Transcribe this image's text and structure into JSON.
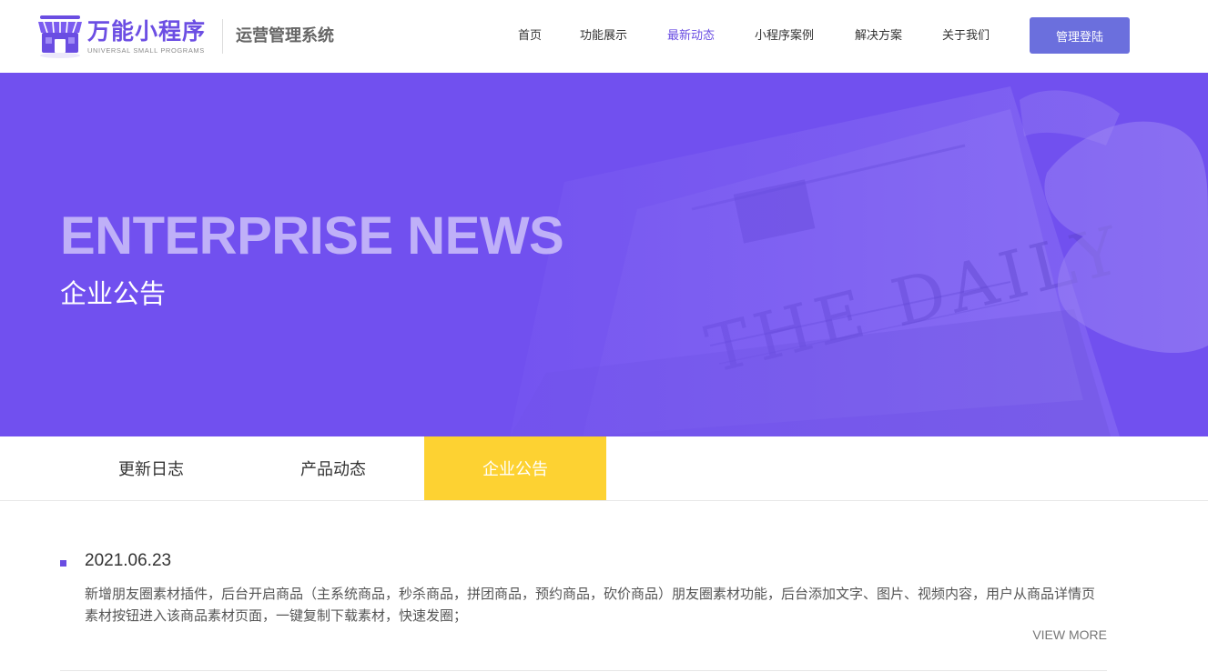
{
  "brand": {
    "name_cn": "万能小程序",
    "name_en": "UNIVERSAL SMALL PROGRAMS",
    "system_title": "运营管理系统",
    "logo_icon": "shop-storefront-icon",
    "accent_color": "#6a4de2"
  },
  "nav": {
    "items": [
      {
        "label": "首页"
      },
      {
        "label": "功能展示"
      },
      {
        "label": "最新动态",
        "active": true
      },
      {
        "label": "小程序案例"
      },
      {
        "label": "解决方案"
      },
      {
        "label": "关于我们"
      }
    ],
    "login_label": "管理登陆",
    "login_color": "#6b6fdd"
  },
  "banner": {
    "title_en": "ENTERPRISE NEWS",
    "title_cn": "企业公告",
    "background_color": "#7150ef"
  },
  "tabs": {
    "items": [
      {
        "label": "更新日志"
      },
      {
        "label": "产品动态"
      },
      {
        "label": "企业公告",
        "active": true
      }
    ],
    "active_color": "#fdd232"
  },
  "news": {
    "items": [
      {
        "date": "2021.06.23",
        "desc": "新增朋友圈素材插件，后台开启商品（主系统商品，秒杀商品，拼团商品，预约商品，砍价商品）朋友圈素材功能，后台添加文字、图片、视频内容，用户从商品详情页素材按钮进入该商品素材页面，一键复制下载素材，快速发圈；",
        "more_label": "VIEW MORE"
      }
    ]
  }
}
